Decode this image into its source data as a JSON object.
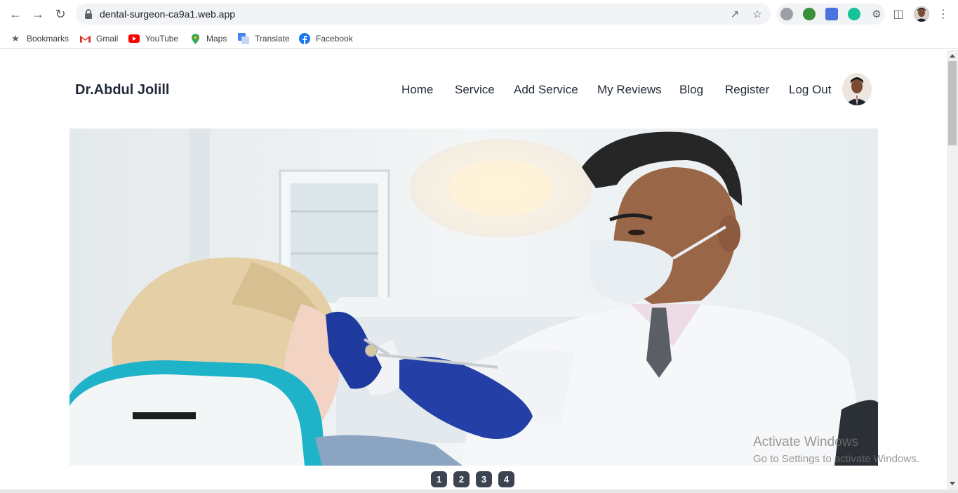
{
  "browser": {
    "url": "dental-surgeon-ca9a1.web.app",
    "bookmarks": [
      {
        "label": "Bookmarks",
        "icon": "star-icon"
      },
      {
        "label": "Gmail",
        "icon": "gmail-icon"
      },
      {
        "label": "YouTube",
        "icon": "youtube-icon"
      },
      {
        "label": "Maps",
        "icon": "maps-icon"
      },
      {
        "label": "Translate",
        "icon": "translate-icon"
      },
      {
        "label": "Facebook",
        "icon": "facebook-icon"
      }
    ]
  },
  "site": {
    "brand": "Dr.Abdul Jolill",
    "nav": [
      "Home",
      "Service",
      "Add Service",
      "My Reviews",
      "Blog",
      "Register",
      "Log Out"
    ]
  },
  "carousel": {
    "pages": [
      "1",
      "2",
      "3",
      "4"
    ]
  },
  "os_watermark": {
    "line1": "Activate Windows",
    "line2": "Go to Settings to activate Windows."
  },
  "colors": {
    "accent_glove": "#1f3a9e",
    "chair": "#1fb3c9",
    "dot_bg": "#3d4451"
  }
}
